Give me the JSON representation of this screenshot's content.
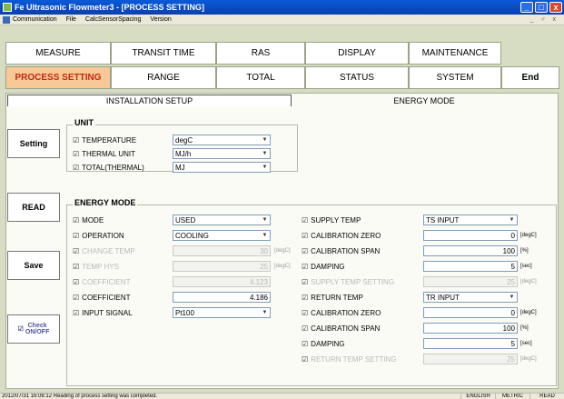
{
  "window": {
    "title": "Fe Ultrasonic Flowmeter3 - [PROCESS SETTING]",
    "min_label": "_",
    "max_label": "□",
    "close_label": "x"
  },
  "menu": {
    "items": [
      "Communication",
      "File",
      "CalcSensorSpacing",
      "Version"
    ],
    "right_controls": "_ ♂ x"
  },
  "top_tabs": {
    "row1": [
      "MEASURE",
      "TRANSIT TIME",
      "RAS",
      "DISPLAY",
      "MAINTENANCE"
    ],
    "row2": [
      "PROCESS SETTING",
      "RANGE",
      "TOTAL",
      "STATUS",
      "SYSTEM"
    ],
    "end": "End",
    "active": "PROCESS SETTING"
  },
  "sub_tabs": {
    "left": "INSTALLATION SETUP",
    "right": "ENERGY MODE"
  },
  "side_buttons": {
    "setting": "Setting",
    "read": "READ",
    "save": "Save",
    "check_mark": "☑",
    "check_line1": "Check",
    "check_line2": "ON/OFF"
  },
  "unit_group": {
    "title": "UNIT",
    "rows": [
      {
        "label": "TEMPERATURE",
        "value": "degC"
      },
      {
        "label": "THERMAL UNIT",
        "value": "MJ/h"
      },
      {
        "label": "TOTAL(THERMAL)",
        "value": "MJ"
      }
    ]
  },
  "energy_group": {
    "title": "ENERGY MODE",
    "left_rows": [
      {
        "label": "MODE",
        "kind": "select",
        "value": "USED",
        "unit": "",
        "enabled": true
      },
      {
        "label": "OPERATION",
        "kind": "select",
        "value": "COOLING",
        "unit": "",
        "enabled": true
      },
      {
        "label": "CHANGE TEMP",
        "kind": "number",
        "value": "30",
        "unit": "[degC]",
        "enabled": false
      },
      {
        "label": "TEMP HYS",
        "kind": "number",
        "value": "25",
        "unit": "[degC]",
        "enabled": false
      },
      {
        "label": "COEFFICIENT",
        "kind": "number",
        "value": "4.123",
        "unit": "",
        "enabled": false
      },
      {
        "label": "COEFFICIENT",
        "kind": "number",
        "value": "4.186",
        "unit": "",
        "enabled": true
      },
      {
        "label": "INPUT SIGNAL",
        "kind": "select",
        "value": "Pt100",
        "unit": "",
        "enabled": true
      }
    ],
    "right_rows": [
      {
        "label": "SUPPLY TEMP",
        "kind": "select",
        "value": "TS INPUT",
        "unit": "",
        "enabled": true
      },
      {
        "label": "CALIBRATION ZERO",
        "kind": "number",
        "value": "0",
        "unit": "[degC]",
        "enabled": true
      },
      {
        "label": "CALIBRATION SPAN",
        "kind": "number",
        "value": "100",
        "unit": "[%]",
        "enabled": true
      },
      {
        "label": "DAMPING",
        "kind": "number",
        "value": "5",
        "unit": "[sec]",
        "enabled": true
      },
      {
        "label": "SUPPLY TEMP SETTING",
        "kind": "number",
        "value": "25",
        "unit": "[degC]",
        "enabled": false
      },
      {
        "label": "RETURN TEMP",
        "kind": "select",
        "value": "TR INPUT",
        "unit": "",
        "enabled": true
      },
      {
        "label": "CALIBRATION ZERO",
        "kind": "number",
        "value": "0",
        "unit": "[degC]",
        "enabled": true
      },
      {
        "label": "CALIBRATION SPAN",
        "kind": "number",
        "value": "100",
        "unit": "[%]",
        "enabled": true
      },
      {
        "label": "DAMPING",
        "kind": "number",
        "value": "5",
        "unit": "[sec]",
        "enabled": true
      },
      {
        "label": "RETURN TEMP SETTING",
        "kind": "number",
        "value": "25",
        "unit": "[degC]",
        "enabled": false
      }
    ]
  },
  "status_bar": {
    "message": "2012/07/31 16:08:12 Reading of process setting was completed.",
    "language": "ENGLISH",
    "units": "METRIC",
    "mode": "READ"
  }
}
